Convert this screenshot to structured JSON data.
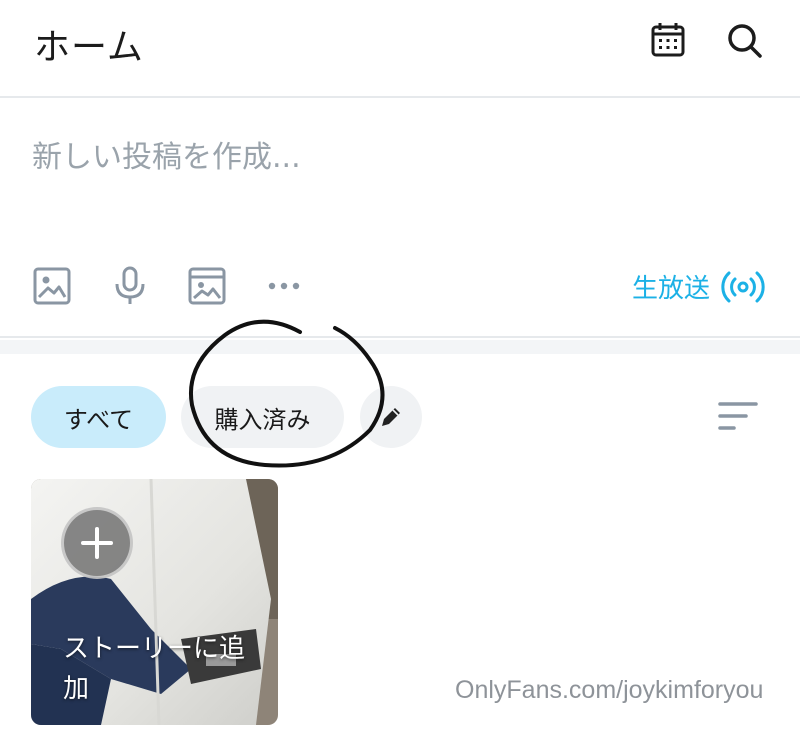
{
  "header": {
    "title": "ホーム",
    "icons": [
      "calendar-icon",
      "search-icon"
    ]
  },
  "composer": {
    "placeholder": "新しい投稿を作成...",
    "tools": [
      "image-icon",
      "microphone-icon",
      "vault-icon",
      "more-icon"
    ],
    "live_label": "生放送",
    "live_color": "#1cb1e6"
  },
  "filters": {
    "chips": [
      {
        "label": "すべて",
        "active": true
      },
      {
        "label": "購入済み",
        "active": false
      }
    ],
    "active_color": "#c9ecfb",
    "inactive_color": "#f0f2f4"
  },
  "story": {
    "label": "ストーリーに追加"
  },
  "watermark": "OnlyFans.com/joykimforyou"
}
